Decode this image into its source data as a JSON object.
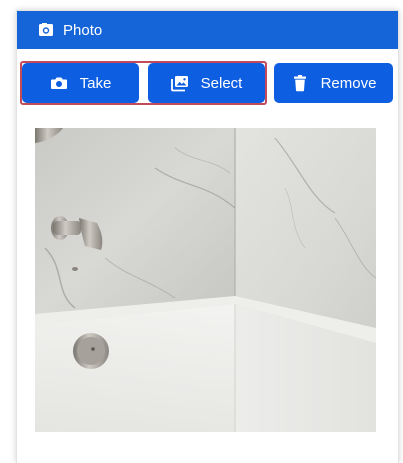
{
  "header": {
    "title": "Photo",
    "icon": "camera-box-icon",
    "background": "#1565d8"
  },
  "toolbar": {
    "take_label": "Take",
    "take_icon": "camera-icon",
    "select_label": "Select",
    "select_icon": "image-icon",
    "remove_label": "Remove",
    "remove_icon": "trash-icon",
    "button_color": "#0d5ee0",
    "selection_outline_color": "#c24a5a"
  }
}
